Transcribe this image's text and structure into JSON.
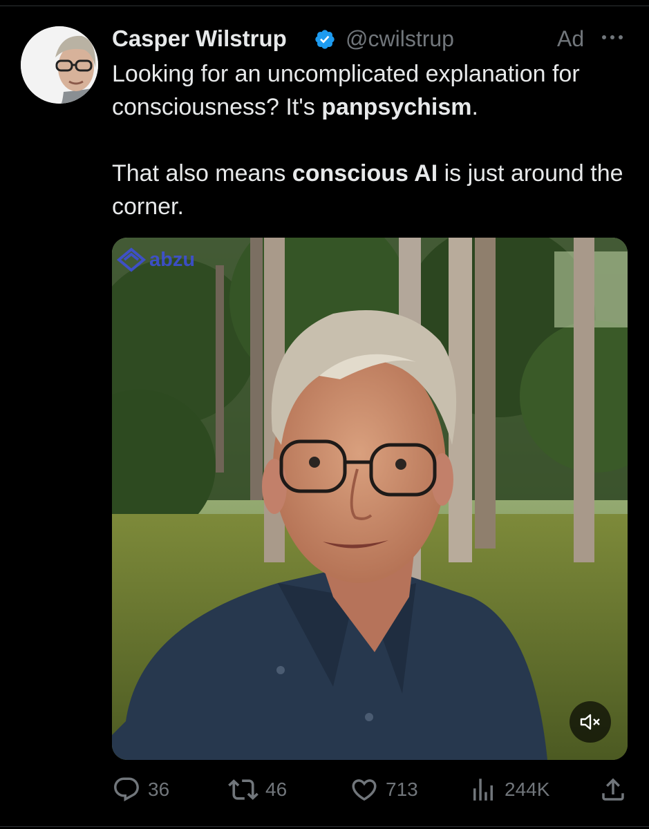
{
  "tweet": {
    "author": {
      "name": "Casper Wilstrup",
      "handle": "@cwilstrup",
      "verified": true
    },
    "ad_label": "Ad",
    "text": {
      "p1_a": "Looking for an uncomplicated explanation for consciousness? It's ",
      "p1_bold": "panpsychism",
      "p1_b": ".",
      "p2_a": "That also means ",
      "p2_bold": "conscious AI",
      "p2_b": " is just around the corner."
    },
    "media": {
      "watermark": "abzu",
      "mute_icon": "speaker-muted-icon"
    },
    "stats": {
      "replies": "36",
      "reposts": "46",
      "likes": "713",
      "views": "244K"
    }
  },
  "colors": {
    "background": "#000000",
    "text": "#e7e9ea",
    "muted": "#71767b",
    "verified": "#1d9bf0",
    "watermark": "#3e4fe0"
  }
}
